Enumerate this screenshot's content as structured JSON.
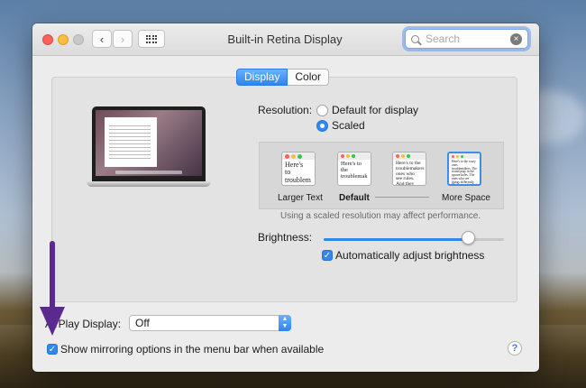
{
  "window": {
    "title": "Built-in Retina Display"
  },
  "toolbar": {
    "back_glyph": "‹",
    "forward_glyph": "›",
    "show_all_icon": "grid-icon"
  },
  "search": {
    "placeholder": "Search",
    "value": "",
    "clear_glyph": "×"
  },
  "tabs": [
    {
      "label": "Display",
      "active": true
    },
    {
      "label": "Color",
      "active": false
    }
  ],
  "resolution": {
    "label": "Resolution:",
    "options": [
      {
        "label": "Default for display",
        "selected": false
      },
      {
        "label": "Scaled",
        "selected": true
      }
    ],
    "scaled_options": [
      {
        "label": "Larger Text",
        "preview_text": "Here's to troublem",
        "selected": false,
        "bold": false
      },
      {
        "label": "Default",
        "preview_text": "Here's to the troublemak",
        "selected": false,
        "bold": true
      },
      {
        "label": "",
        "preview_text": "Here's to the troublemakers ones who see rules. And they",
        "selected": false,
        "bold": false
      },
      {
        "label": "More Space",
        "preview_text": "Here's to the crazy ones troublemakers. The round pegs in the square holes. The ones who see things differently. They're not fond of rules. And they have no respect for the status quo. You can quote them, disagree with them, glorify or vilify them. About the only thing you can't do is ignore them. Because they change things.",
        "selected": true,
        "bold": false
      }
    ],
    "note": "Using a scaled resolution may affect performance."
  },
  "brightness": {
    "label": "Brightness:",
    "value": 0.8,
    "auto_label": "Automatically adjust brightness",
    "auto_checked": true
  },
  "airplay": {
    "label": "AirPlay Display:",
    "value": "Off"
  },
  "mirroring": {
    "label": "Show mirroring options in the menu bar when available",
    "checked": true
  },
  "help": {
    "glyph": "?"
  },
  "colors": {
    "accent": "#2e88f0",
    "annotation_arrow": "#5a2a8e"
  }
}
